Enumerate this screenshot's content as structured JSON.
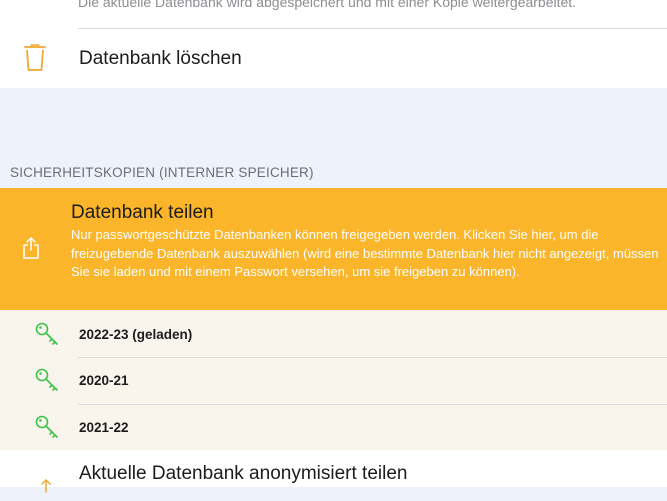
{
  "top_row": {
    "cutoff_text": "Die aktuelle Datenbank wird abgespeichert und mit einer Kopie weitergearbeitet.",
    "delete_label": "Datenbank löschen"
  },
  "section": {
    "header": "SICHERHEITSKOPIEN (INTERNER SPEICHER)"
  },
  "share": {
    "title": "Datenbank teilen",
    "description": "Nur passwortgeschützte Datenbanken können freigegeben werden. Klicken Sie hier, um die freizugebende Datenbank auszuwählen (wird eine bestimmte Datenbank hier nicht angezeigt, müssen Sie sie laden und mit einem Passwort versehen, um sie freigeben zu können)."
  },
  "databases": [
    {
      "label": "2022-23 (geladen)"
    },
    {
      "label": "2020-21"
    },
    {
      "label": "2021-22"
    }
  ],
  "bottom_row": {
    "label": "Aktuelle Datenbank anonymisiert teilen"
  },
  "colors": {
    "accent_orange": "#fbb52b",
    "icon_orange": "#f0a830",
    "key_green": "#3cc24b",
    "share_text": "#ffffff"
  },
  "icons": {
    "delete": "trash-icon",
    "share": "share-icon",
    "database": "key-icon",
    "bottom": "share-icon"
  }
}
